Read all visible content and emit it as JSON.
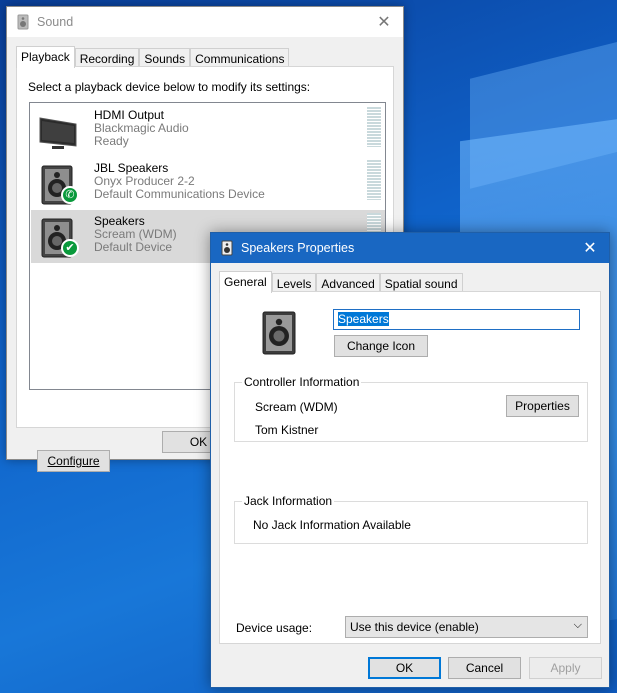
{
  "sound_window": {
    "title": "Sound",
    "close_glyph": "✕",
    "tabs": [
      "Playback",
      "Recording",
      "Sounds",
      "Communications"
    ],
    "active_tab": "Playback",
    "instruction": "Select a playback device below to modify its settings:",
    "devices": [
      {
        "name": "HDMI Output",
        "line2": "Blackmagic Audio",
        "line3": "Ready",
        "icon": "monitor-icon",
        "badge": ""
      },
      {
        "name": "JBL Speakers",
        "line2": "Onyx Producer 2-2",
        "line3": "Default Communications Device",
        "icon": "speaker-icon",
        "badge": "phone-icon"
      },
      {
        "name": "Speakers",
        "line2": "Scream (WDM)",
        "line3": "Default Device",
        "icon": "speaker-icon",
        "badge": "check-icon",
        "selected": true
      }
    ],
    "configure_label": "Configure",
    "ok_label": "OK"
  },
  "props_window": {
    "title": "Speakers Properties",
    "close_glyph": "✕",
    "tabs": [
      "General",
      "Levels",
      "Advanced",
      "Spatial sound"
    ],
    "active_tab": "General",
    "device_name": "Speakers",
    "change_icon_label": "Change Icon",
    "controller": {
      "legend": "Controller Information",
      "name": "Scream (WDM)",
      "manufacturer": "Tom Kistner",
      "properties_label": "Properties"
    },
    "jack": {
      "legend": "Jack Information",
      "text": "No Jack Information Available"
    },
    "usage_label": "Device usage:",
    "usage_value": "Use this device (enable)",
    "buttons": {
      "ok": "OK",
      "cancel": "Cancel",
      "apply": "Apply"
    }
  },
  "colors": {
    "accent": "#0078d7",
    "titlebar_active": "#1967c2",
    "badge_green": "#0a9a3c",
    "selected_row": "#d9d9d9"
  }
}
